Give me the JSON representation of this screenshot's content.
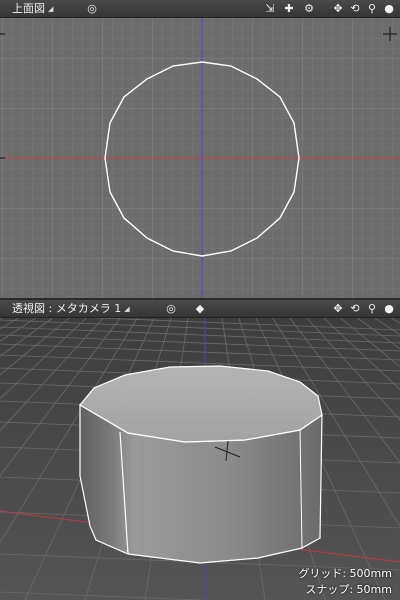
{
  "top_view": {
    "title": "上面図",
    "dropdown_glyph": "◢",
    "icons": {
      "target": "◎",
      "select_mode": "⇲",
      "edit_mode": "✚",
      "settings": "⚙",
      "move": "✥",
      "rotate": "⟲",
      "zoom": "⚲",
      "shade": "●"
    }
  },
  "perspective_view": {
    "title": "透視図 : メタカメラ 1",
    "dropdown_glyph": "◢",
    "icons": {
      "target": "◎",
      "cube": "◆",
      "move": "✥",
      "rotate": "⟲",
      "zoom": "⚲",
      "shade": "●"
    },
    "grid_label": "グリッド: 500mm",
    "snap_label": "スナップ: 50mm"
  },
  "colors": {
    "x_axis": "#d23b3b",
    "y_axis": "#3b3bd2",
    "grid": "#7a7a7a",
    "outline": "#ffffff"
  }
}
